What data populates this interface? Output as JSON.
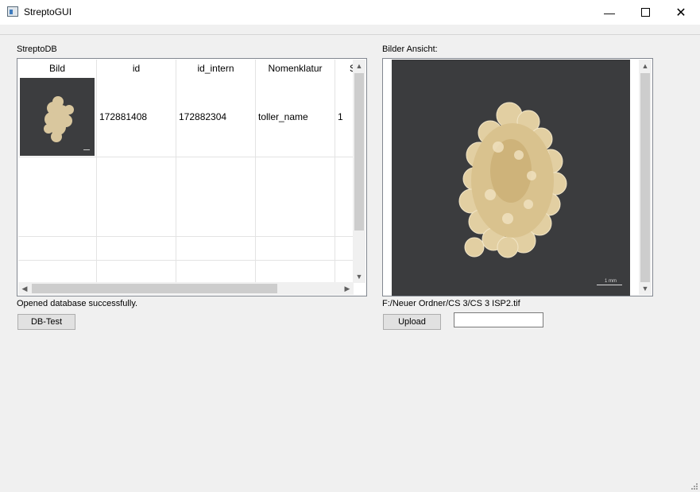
{
  "window": {
    "title": "StreptoGUI",
    "icon": "app-window-icon",
    "controls": [
      "minimize-icon",
      "maximize-icon",
      "close-icon"
    ]
  },
  "left_panel": {
    "label": "StreptoDB",
    "table": {
      "columns": [
        "Bild",
        "id",
        "id_intern",
        "Nomenklatur",
        "S"
      ],
      "rows": [
        {
          "bild": "colony-thumbnail",
          "id": "172881408",
          "id_intern": "172882304",
          "nomenklatur": "toller_name",
          "s": "1"
        }
      ]
    },
    "status": "Opened database successfully.",
    "db_test_button": "DB-Test"
  },
  "right_panel": {
    "label": "Bilder Ansicht:",
    "scale_bar_text": "1 mm",
    "file_path": "F:/Neuer Ordner/CS 3/CS 3  ISP2.tif",
    "upload_button": "Upload",
    "upload_input_value": ""
  },
  "colors": {
    "window_bg": "#f0f0f0",
    "image_bg": "#3b3c3e",
    "colony": "#e8d7b0"
  }
}
